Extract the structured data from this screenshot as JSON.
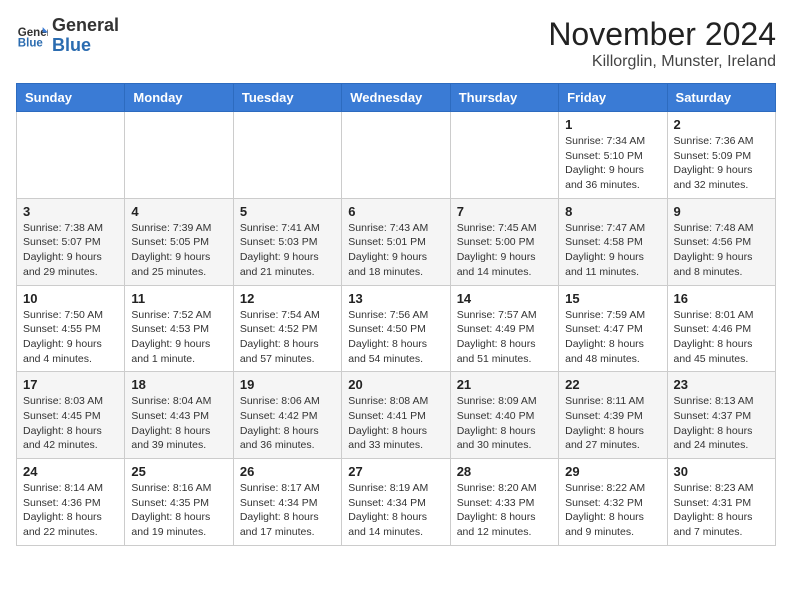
{
  "header": {
    "logo_general": "General",
    "logo_blue": "Blue",
    "month_title": "November 2024",
    "subtitle": "Killorglin, Munster, Ireland"
  },
  "weekdays": [
    "Sunday",
    "Monday",
    "Tuesday",
    "Wednesday",
    "Thursday",
    "Friday",
    "Saturday"
  ],
  "weeks": [
    [
      {
        "day": "",
        "info": ""
      },
      {
        "day": "",
        "info": ""
      },
      {
        "day": "",
        "info": ""
      },
      {
        "day": "",
        "info": ""
      },
      {
        "day": "",
        "info": ""
      },
      {
        "day": "1",
        "info": "Sunrise: 7:34 AM\nSunset: 5:10 PM\nDaylight: 9 hours and 36 minutes."
      },
      {
        "day": "2",
        "info": "Sunrise: 7:36 AM\nSunset: 5:09 PM\nDaylight: 9 hours and 32 minutes."
      }
    ],
    [
      {
        "day": "3",
        "info": "Sunrise: 7:38 AM\nSunset: 5:07 PM\nDaylight: 9 hours and 29 minutes."
      },
      {
        "day": "4",
        "info": "Sunrise: 7:39 AM\nSunset: 5:05 PM\nDaylight: 9 hours and 25 minutes."
      },
      {
        "day": "5",
        "info": "Sunrise: 7:41 AM\nSunset: 5:03 PM\nDaylight: 9 hours and 21 minutes."
      },
      {
        "day": "6",
        "info": "Sunrise: 7:43 AM\nSunset: 5:01 PM\nDaylight: 9 hours and 18 minutes."
      },
      {
        "day": "7",
        "info": "Sunrise: 7:45 AM\nSunset: 5:00 PM\nDaylight: 9 hours and 14 minutes."
      },
      {
        "day": "8",
        "info": "Sunrise: 7:47 AM\nSunset: 4:58 PM\nDaylight: 9 hours and 11 minutes."
      },
      {
        "day": "9",
        "info": "Sunrise: 7:48 AM\nSunset: 4:56 PM\nDaylight: 9 hours and 8 minutes."
      }
    ],
    [
      {
        "day": "10",
        "info": "Sunrise: 7:50 AM\nSunset: 4:55 PM\nDaylight: 9 hours and 4 minutes."
      },
      {
        "day": "11",
        "info": "Sunrise: 7:52 AM\nSunset: 4:53 PM\nDaylight: 9 hours and 1 minute."
      },
      {
        "day": "12",
        "info": "Sunrise: 7:54 AM\nSunset: 4:52 PM\nDaylight: 8 hours and 57 minutes."
      },
      {
        "day": "13",
        "info": "Sunrise: 7:56 AM\nSunset: 4:50 PM\nDaylight: 8 hours and 54 minutes."
      },
      {
        "day": "14",
        "info": "Sunrise: 7:57 AM\nSunset: 4:49 PM\nDaylight: 8 hours and 51 minutes."
      },
      {
        "day": "15",
        "info": "Sunrise: 7:59 AM\nSunset: 4:47 PM\nDaylight: 8 hours and 48 minutes."
      },
      {
        "day": "16",
        "info": "Sunrise: 8:01 AM\nSunset: 4:46 PM\nDaylight: 8 hours and 45 minutes."
      }
    ],
    [
      {
        "day": "17",
        "info": "Sunrise: 8:03 AM\nSunset: 4:45 PM\nDaylight: 8 hours and 42 minutes."
      },
      {
        "day": "18",
        "info": "Sunrise: 8:04 AM\nSunset: 4:43 PM\nDaylight: 8 hours and 39 minutes."
      },
      {
        "day": "19",
        "info": "Sunrise: 8:06 AM\nSunset: 4:42 PM\nDaylight: 8 hours and 36 minutes."
      },
      {
        "day": "20",
        "info": "Sunrise: 8:08 AM\nSunset: 4:41 PM\nDaylight: 8 hours and 33 minutes."
      },
      {
        "day": "21",
        "info": "Sunrise: 8:09 AM\nSunset: 4:40 PM\nDaylight: 8 hours and 30 minutes."
      },
      {
        "day": "22",
        "info": "Sunrise: 8:11 AM\nSunset: 4:39 PM\nDaylight: 8 hours and 27 minutes."
      },
      {
        "day": "23",
        "info": "Sunrise: 8:13 AM\nSunset: 4:37 PM\nDaylight: 8 hours and 24 minutes."
      }
    ],
    [
      {
        "day": "24",
        "info": "Sunrise: 8:14 AM\nSunset: 4:36 PM\nDaylight: 8 hours and 22 minutes."
      },
      {
        "day": "25",
        "info": "Sunrise: 8:16 AM\nSunset: 4:35 PM\nDaylight: 8 hours and 19 minutes."
      },
      {
        "day": "26",
        "info": "Sunrise: 8:17 AM\nSunset: 4:34 PM\nDaylight: 8 hours and 17 minutes."
      },
      {
        "day": "27",
        "info": "Sunrise: 8:19 AM\nSunset: 4:34 PM\nDaylight: 8 hours and 14 minutes."
      },
      {
        "day": "28",
        "info": "Sunrise: 8:20 AM\nSunset: 4:33 PM\nDaylight: 8 hours and 12 minutes."
      },
      {
        "day": "29",
        "info": "Sunrise: 8:22 AM\nSunset: 4:32 PM\nDaylight: 8 hours and 9 minutes."
      },
      {
        "day": "30",
        "info": "Sunrise: 8:23 AM\nSunset: 4:31 PM\nDaylight: 8 hours and 7 minutes."
      }
    ]
  ]
}
